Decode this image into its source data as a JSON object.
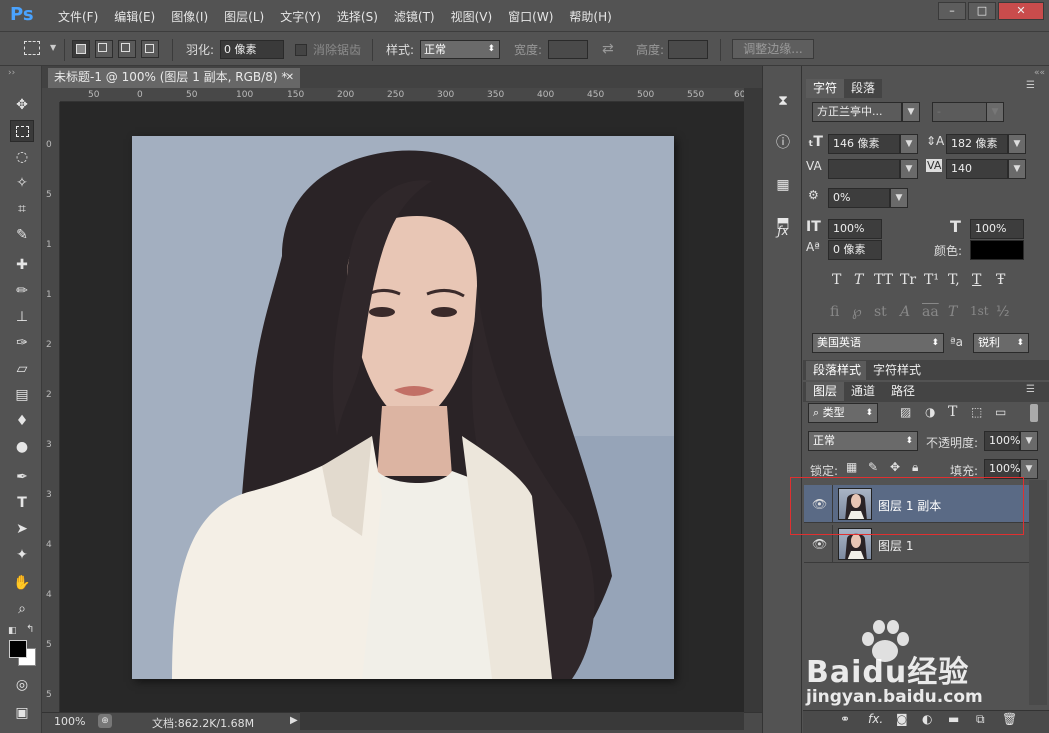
{
  "app": {
    "logo": "Ps"
  },
  "menu": [
    "文件(F)",
    "编辑(E)",
    "图像(I)",
    "图层(L)",
    "文字(Y)",
    "选择(S)",
    "滤镜(T)",
    "视图(V)",
    "窗口(W)",
    "帮助(H)"
  ],
  "window_controls": [
    "–",
    "□",
    "✕"
  ],
  "options": {
    "feather_label": "羽化:",
    "feather_value": "0 像素",
    "antialias_label": "消除锯齿",
    "style_label": "样式:",
    "style_value": "正常",
    "width_label": "宽度:",
    "height_label": "高度:",
    "refine_edge": "调整边缘..."
  },
  "document": {
    "tab_title": "未标题-1 @ 100% (图层 1 副本, RGB/8) *",
    "zoom": "100%",
    "doc_info": "文档:862.2K/1.68M",
    "ruler_h": [
      "50",
      "0",
      "50",
      "100",
      "150",
      "200",
      "250",
      "300",
      "350",
      "400",
      "450",
      "500",
      "550",
      "60"
    ],
    "ruler_v": [
      "0",
      "5",
      "1",
      "1",
      "2",
      "2",
      "3",
      "3",
      "4",
      "4",
      "5",
      "5"
    ]
  },
  "character_panel": {
    "tabs": [
      "字符",
      "段落"
    ],
    "font_family": "方正兰亭中...",
    "font_style": "-",
    "size": "146 像素",
    "leading": "182 像素",
    "kerning": "",
    "tracking": "140",
    "tsume": "0%",
    "vertical_scale": "100%",
    "horizontal_scale": "100%",
    "baseline_shift": "0 像素",
    "color_label": "颜色:",
    "color": "#000000",
    "style_buttons": [
      "T",
      "T",
      "TT",
      "Tr",
      "T¹",
      "T,",
      "T",
      "Ŧ"
    ],
    "opentype_buttons": [
      "fi",
      "℘",
      "st",
      "A",
      "aa",
      "T",
      "1st",
      "½"
    ],
    "language": "美国英语",
    "aa_icon": "ªa",
    "antialias": "锐利"
  },
  "paragraph_styles_tabs": [
    "段落样式",
    "字符样式"
  ],
  "layers_panel": {
    "tabs": [
      "图层",
      "通道",
      "路径"
    ],
    "filter_label": "类型",
    "blend_mode": "正常",
    "opacity_label": "不透明度:",
    "opacity": "100%",
    "lock_label": "锁定:",
    "fill_label": "填充:",
    "fill": "100%",
    "layers": [
      {
        "name": "图层 1 副本",
        "selected": true
      },
      {
        "name": "图层 1",
        "selected": false
      }
    ],
    "bottom_icons": [
      "link-icon",
      "fx-icon",
      "mask-icon",
      "adjustment-icon",
      "group-icon",
      "new-layer-icon",
      "delete-icon"
    ]
  },
  "watermark": {
    "brand": "Baidu经验",
    "url": "jingyan.baidu.com"
  },
  "colors": {
    "accent": "#4aa3ff",
    "selection": "#e03030",
    "layer_selected": "#5a6a85"
  }
}
